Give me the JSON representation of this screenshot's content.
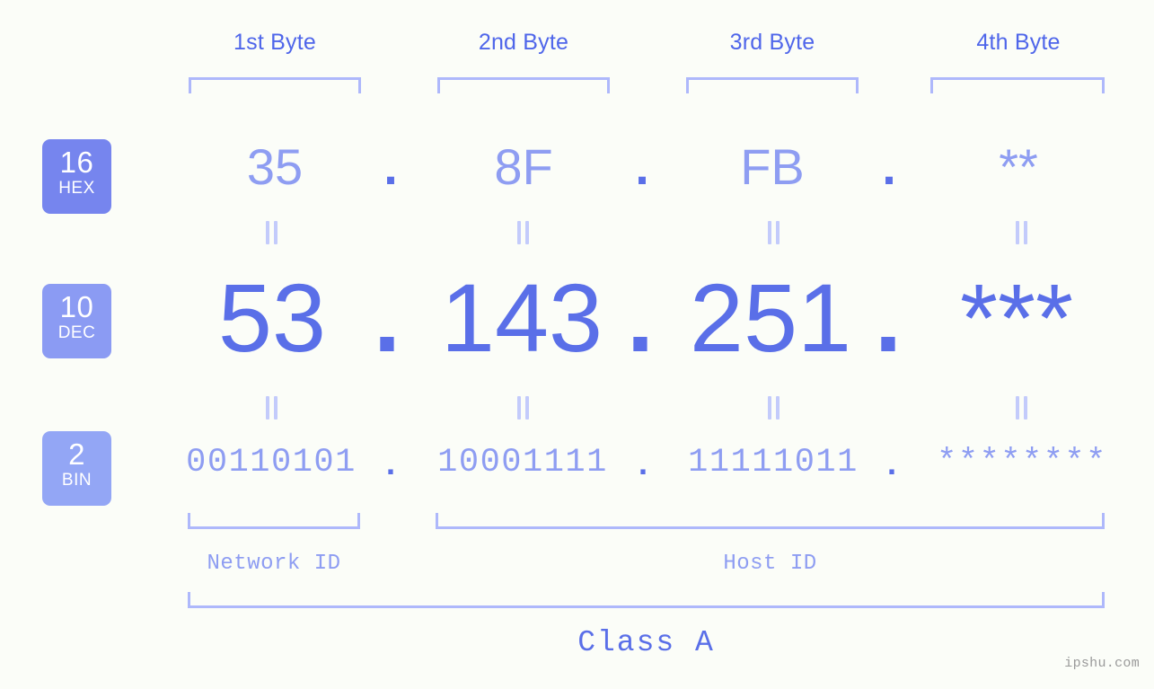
{
  "meta": {
    "background_color": "#fbfdf8",
    "accent_color": "#5a6fe8",
    "accent_light_color": "#8e9df2",
    "bracket_color": "#aeb8fb",
    "watermark": "ipshu.com"
  },
  "byte_headers": [
    {
      "label": "1st Byte"
    },
    {
      "label": "2nd Byte"
    },
    {
      "label": "3rd Byte"
    },
    {
      "label": "4th Byte"
    }
  ],
  "bases": [
    {
      "id": "hex",
      "number": "16",
      "name": "HEX",
      "color": "#7685ee"
    },
    {
      "id": "dec",
      "number": "10",
      "name": "DEC",
      "color": "#8b9bf3"
    },
    {
      "id": "bin",
      "number": "2",
      "name": "BIN",
      "color": "#93a6f5"
    }
  ],
  "rows": {
    "hex": {
      "base_label": "16",
      "base_name": "HEX",
      "values": [
        "35",
        "8F",
        "FB",
        "**"
      ],
      "separators": [
        ".",
        ".",
        "."
      ]
    },
    "dec": {
      "base_label": "10",
      "base_name": "DEC",
      "values": [
        "53",
        "143",
        "251",
        "***"
      ],
      "separators": [
        ".",
        ".",
        "."
      ]
    },
    "bin": {
      "base_label": "2",
      "base_name": "BIN",
      "values": [
        "00110101",
        "10001111",
        "11111011",
        "********"
      ],
      "separators": [
        ".",
        ".",
        "."
      ]
    }
  },
  "equality_marks": {
    "symbol": "=",
    "hex_to_dec_count": 4,
    "dec_to_bin_count": 4
  },
  "segments": {
    "network_id": {
      "label": "Network ID"
    },
    "host_id": {
      "label": "Host ID"
    },
    "address_class": {
      "label": "Class A"
    }
  },
  "chart_data": {
    "type": "table",
    "title": "IPv4 Address Byte Breakdown",
    "columns": [
      "1st Byte",
      "2nd Byte",
      "3rd Byte",
      "4th Byte"
    ],
    "rows": [
      {
        "name": "HEX (base 16)",
        "values": [
          "35",
          "8F",
          "FB",
          "**"
        ]
      },
      {
        "name": "DEC (base 10)",
        "values": [
          "53",
          "143",
          "251",
          "***"
        ]
      },
      {
        "name": "BIN (base 2)",
        "values": [
          "00110101",
          "10001111",
          "11111011",
          "********"
        ]
      }
    ],
    "annotations": {
      "network_id_span": [
        "1st Byte"
      ],
      "host_id_span": [
        "2nd Byte",
        "3rd Byte",
        "4th Byte"
      ],
      "address_class": "Class A"
    }
  }
}
